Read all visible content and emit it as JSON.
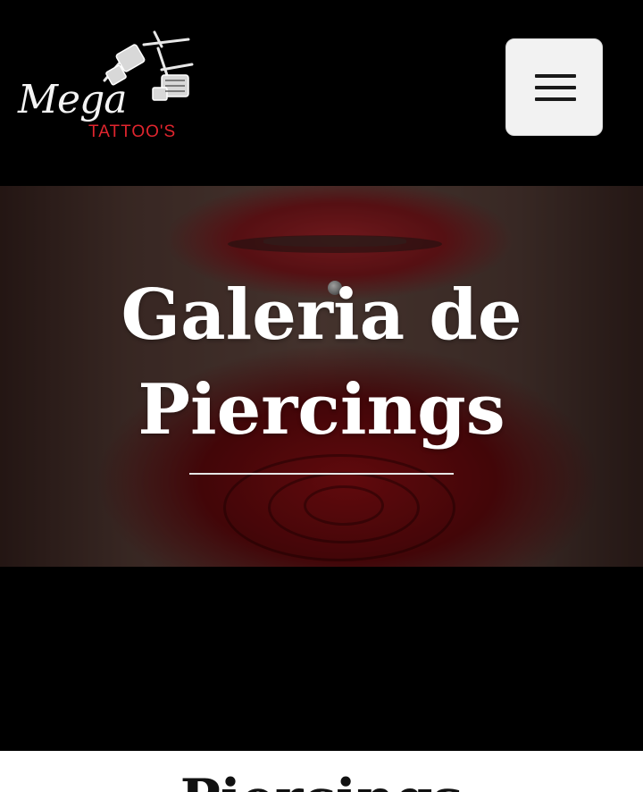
{
  "header": {
    "logo": {
      "script_text": "Mega",
      "subtitle": "TATTOO'S",
      "icon": "tattoo-machines-icon"
    },
    "menu_button": {
      "icon": "hamburger-menu-icon"
    }
  },
  "hero": {
    "title": "Galeria de Piercings"
  },
  "section": {
    "title": "Piercings"
  },
  "colors": {
    "background": "#000000",
    "logo_accent": "#e0252e",
    "menu_button_bg": "#f2f2f2",
    "hero_text": "#ffffff",
    "section_bg": "#ffffff"
  }
}
